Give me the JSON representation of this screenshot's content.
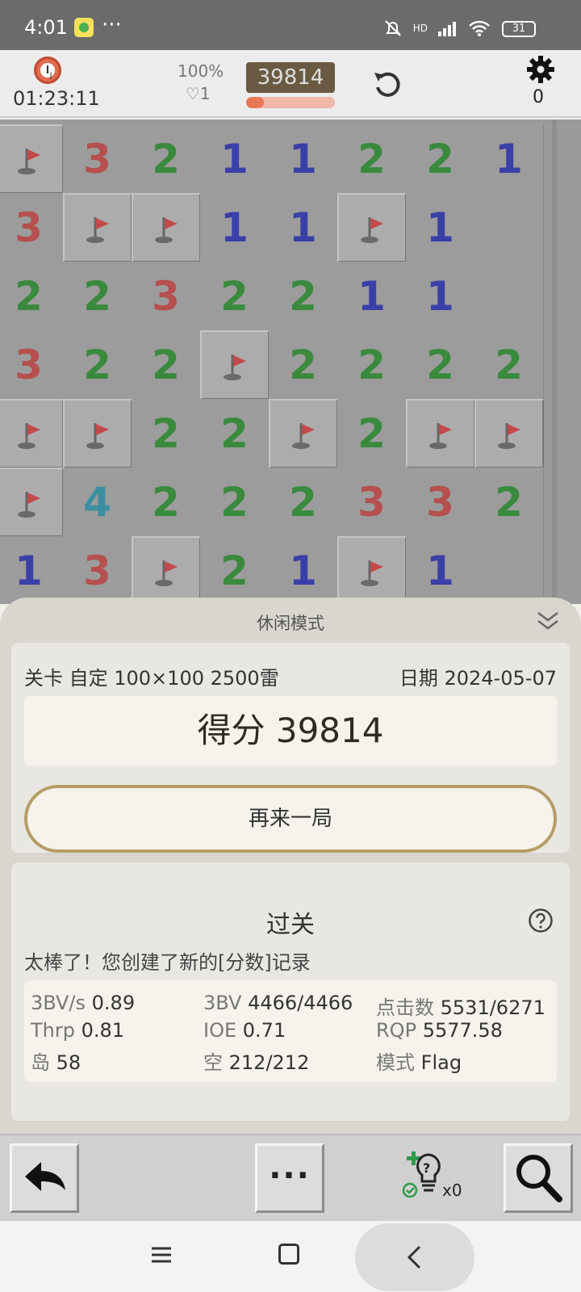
{
  "status": {
    "time": "4:01",
    "dots": "···",
    "network": "HD",
    "battery": "31"
  },
  "topbar": {
    "timer": "01:23:11",
    "percent": "100%",
    "lives": "♡1",
    "score": "39814",
    "progress": 0.2,
    "mine_count": "0"
  },
  "board": {
    "rows": [
      [
        "F",
        "3",
        "2",
        "1",
        "1",
        "2",
        "2",
        "1"
      ],
      [
        "3",
        "F",
        "F",
        "1",
        "1",
        "F",
        "1",
        ""
      ],
      [
        "2",
        "2",
        "3",
        "2",
        "2",
        "1",
        "1",
        ""
      ],
      [
        "3",
        "2",
        "2",
        "F",
        "2",
        "2",
        "2",
        "2"
      ],
      [
        "F",
        "F",
        "2",
        "2",
        "F",
        "2",
        "F",
        "F"
      ],
      [
        "F",
        "4",
        "2",
        "2",
        "2",
        "3",
        "3",
        "2"
      ],
      [
        "1",
        "3",
        "F",
        "2",
        "1",
        "F",
        "1",
        ""
      ]
    ]
  },
  "sheet": {
    "title": "休闲模式",
    "level": "关卡 自定 100×100  2500雷",
    "date": "日期 2024-05-07",
    "score": "得分 39814",
    "again": "再来一局",
    "pass_title": "过关",
    "pass_msg": "太棒了！您创建了新的[分数]记录",
    "stats": {
      "bv_s_k": "3BV/s",
      "bv_s_v": "0.89",
      "bv_k": "3BV",
      "bv_v": "4466/4466",
      "clicks_k": "点击数",
      "clicks_v": "5531/6271",
      "thrp_k": "Thrp",
      "thrp_v": "0.81",
      "ioe_k": "IOE",
      "ioe_v": "0.71",
      "rqp_k": "RQP",
      "rqp_v": "5577.58",
      "island_k": "岛",
      "island_v": "58",
      "empty_k": "空",
      "empty_v": "212/212",
      "mode_k": "模式",
      "mode_v": "Flag"
    }
  },
  "toolbar": {
    "more": "···",
    "hint_count": "x0"
  },
  "icons": [
    "clock-icon",
    "restart-icon",
    "gear-icon",
    "flag-icon",
    "collapse-icon",
    "help-icon",
    "undo-icon",
    "more-icon",
    "hint-icon",
    "search-icon",
    "menu-icon",
    "home-icon",
    "back-icon"
  ]
}
